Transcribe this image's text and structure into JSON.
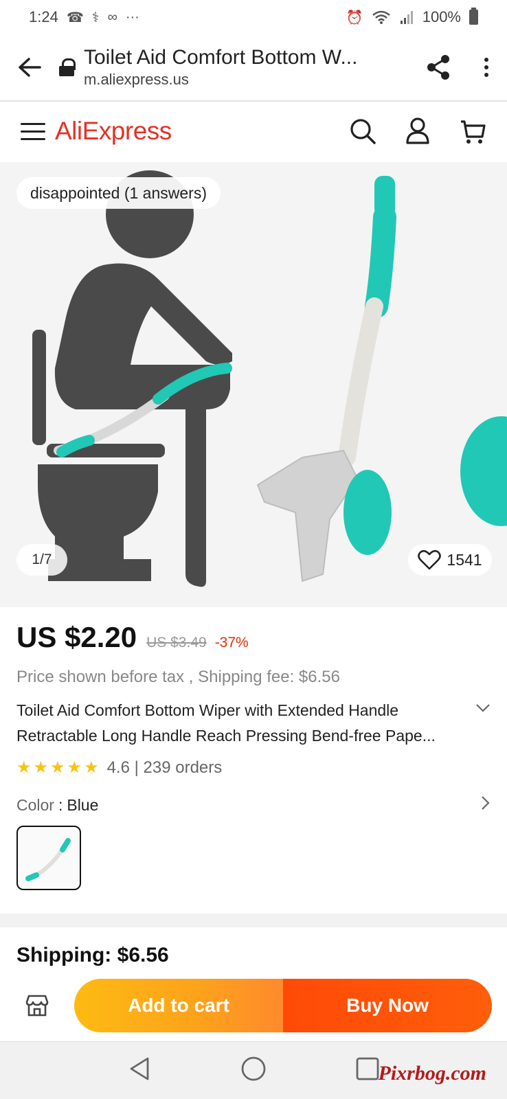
{
  "status_bar": {
    "time": "1:24",
    "extra": "···",
    "battery": "100%"
  },
  "browser": {
    "title": "Toilet Aid Comfort Bottom W...",
    "domain": "m.aliexpress.us"
  },
  "site": {
    "logo": "AliExpress"
  },
  "gallery": {
    "qa_label": "disappointed (1 answers)",
    "counter": "1/7",
    "wishlist_count": "1541"
  },
  "product": {
    "price": "US $2.20",
    "old_price": "US $3.49",
    "discount": "-37%",
    "tax_shipping": "Price shown before tax , Shipping fee: $6.56",
    "title": "Toilet Aid Comfort Bottom Wiper with Extended Handle Retractable Long Handle Reach Pressing Bend-free Pape...",
    "rating_value": 4.6,
    "rating_text": "4.6 | 239 orders",
    "color_label": "Color",
    "color_sep": " : ",
    "color_value": "Blue",
    "shipping": "Shipping: $6.56"
  },
  "actions": {
    "add_to_cart": "Add to cart",
    "buy_now": "Buy Now"
  },
  "watermark": "Pixrbog.com",
  "colors": {
    "brand_red": "#e43225",
    "cart_orange": "#fda21b",
    "buy_red": "#ff4a06",
    "star_yellow": "#f6c40e",
    "teal": "#21c8b6",
    "figure_gray": "#4a4a4a"
  },
  "icons": [
    "back-arrow-icon",
    "lock-icon",
    "share-icon",
    "more-vert-icon",
    "menu-icon",
    "search-icon",
    "account-icon",
    "cart-icon",
    "heart-icon",
    "chevron-down-icon",
    "chevron-right-icon",
    "store-icon",
    "nav-back-icon",
    "nav-home-icon",
    "nav-recents-icon"
  ]
}
